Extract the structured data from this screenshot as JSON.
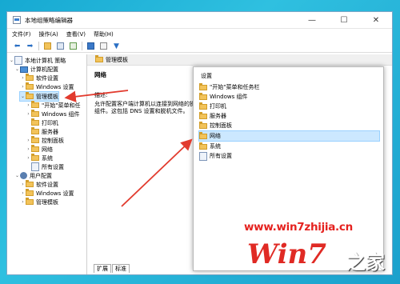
{
  "window": {
    "title": "本地组策略编辑器",
    "minimize": "—",
    "maximize": "☐",
    "close": "✕"
  },
  "menu": [
    "文件(F)",
    "操作(A)",
    "查看(V)",
    "帮助(H)"
  ],
  "toolbar": {
    "icons": [
      "back-arrow-icon",
      "forward-arrow-icon",
      "folder-up-icon",
      "show-tree-icon",
      "export-icon",
      "help-icon",
      "properties-icon",
      "filter-icon"
    ]
  },
  "tree": {
    "root": "本地计算机 策略",
    "computer_config": "计算机配置",
    "software_settings": "软件设置",
    "windows_settings": "Windows 设置",
    "admin_templates": "管理模板",
    "sub_start_menu": "\"开始\"菜单和任",
    "sub_windows_components": "Windows 组件",
    "sub_printers": "打印机",
    "sub_server": "服务器",
    "sub_control_panel": "控制面板",
    "sub_network": "网络",
    "sub_system": "系统",
    "sub_all_settings": "所有设置",
    "user_config": "用户配置",
    "user_software_settings": "软件设置",
    "user_windows_settings": "Windows 设置",
    "user_admin_templates": "管理模板"
  },
  "main": {
    "header": "管理模板",
    "title": "网络",
    "desc_label": "描述:",
    "description": "允许配置客户端计算机以连接到网络的操作系统组件。这包括 DNS 设置和脱机文件。",
    "tabs": [
      "扩展",
      "标准"
    ]
  },
  "popout": {
    "header": "设置",
    "items": [
      "\"开始\"菜单和任务栏",
      "Windows 组件",
      "打印机",
      "服务器",
      "控制面板",
      "网络",
      "系统",
      "所有设置"
    ],
    "selected_index": 5
  },
  "watermark": {
    "url": "www.win7zhijia.cn",
    "logo": "Win7",
    "suffix": "之家"
  },
  "colors": {
    "arrow": "#e23b2e",
    "selection": "#cce8ff",
    "background": "#1ba7d1"
  }
}
